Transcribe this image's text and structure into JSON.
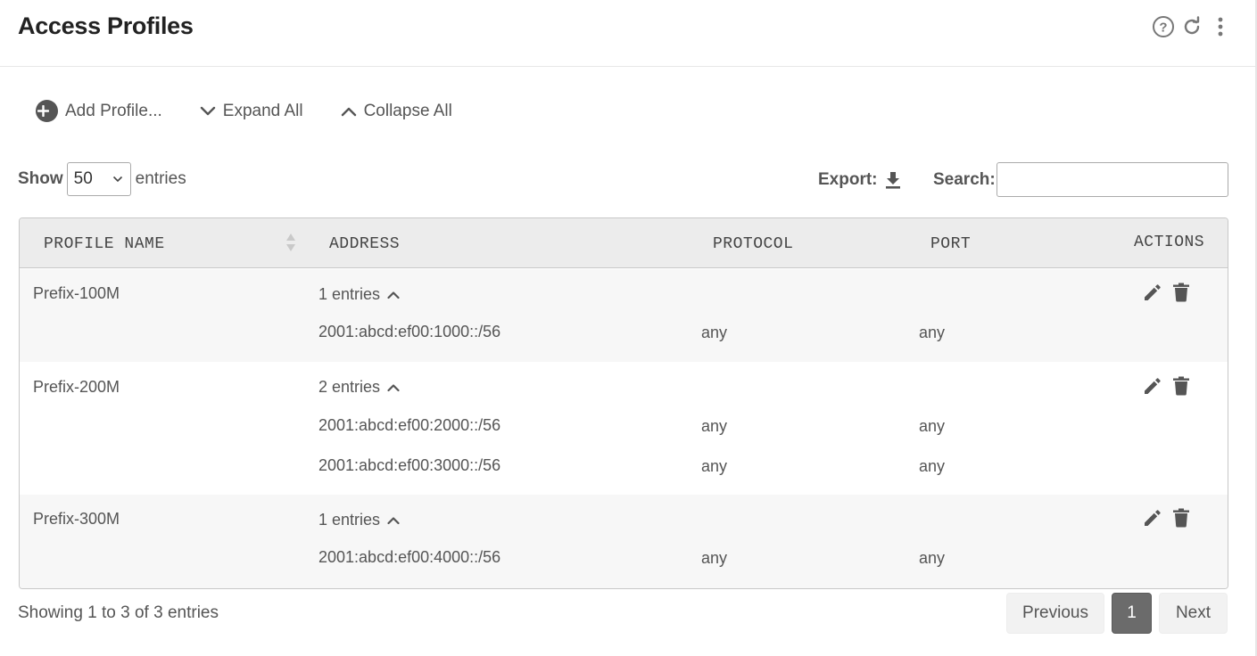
{
  "header": {
    "title": "Access Profiles",
    "icons": [
      "help-circle-icon",
      "refresh-icon",
      "more-vertical-icon"
    ]
  },
  "toolbar": {
    "add_label": "Add Profile...",
    "expand_label": "Expand All",
    "collapse_label": "Collapse All"
  },
  "length": {
    "show_label": "Show",
    "value": "50",
    "entries_label": "entries"
  },
  "export": {
    "label": "Export:"
  },
  "search": {
    "label": "Search:",
    "value": ""
  },
  "table": {
    "columns": [
      "PROFILE NAME",
      "ADDRESS",
      "PROTOCOL",
      "PORT",
      "ACTIONS"
    ],
    "rows": [
      {
        "name": "Prefix-100M",
        "entries_label": "1 entries",
        "entries": [
          {
            "address": "2001:abcd:ef00:1000::/56",
            "protocol": "any",
            "port": "any"
          }
        ]
      },
      {
        "name": "Prefix-200M",
        "entries_label": "2 entries",
        "entries": [
          {
            "address": "2001:abcd:ef00:2000::/56",
            "protocol": "any",
            "port": "any"
          },
          {
            "address": "2001:abcd:ef00:3000::/56",
            "protocol": "any",
            "port": "any"
          }
        ]
      },
      {
        "name": "Prefix-300M",
        "entries_label": "1 entries",
        "entries": [
          {
            "address": "2001:abcd:ef00:4000::/56",
            "protocol": "any",
            "port": "any"
          }
        ]
      }
    ]
  },
  "footer": {
    "info": "Showing 1 to 3 of 3 entries",
    "previous": "Previous",
    "current_page": "1",
    "next": "Next"
  },
  "colors": {
    "icon": "#555555",
    "active_page": "#6b6b6b",
    "header_bg": "#ececec"
  }
}
